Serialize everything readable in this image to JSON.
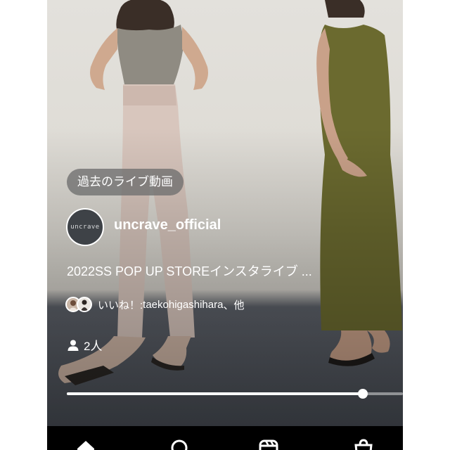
{
  "live": {
    "badge_label": "過去のライブ動画",
    "avatar_text": "uncrave",
    "username": "uncrave_official",
    "title": "2022SS POP UP STOREインスタライブ ...",
    "likes": {
      "label": "いいね！:",
      "user": "taekohigashihara",
      "tail": "、他"
    },
    "viewers": "2人",
    "progress": 0.88
  },
  "bottom_nav": {
    "items": [
      "home-icon",
      "search-icon",
      "reels-icon",
      "shop-icon"
    ]
  },
  "colors": {
    "dress": "#6b6a2f",
    "top": "#8f8b82",
    "pants": "#d8c6bd",
    "floor": "#4d525a"
  }
}
